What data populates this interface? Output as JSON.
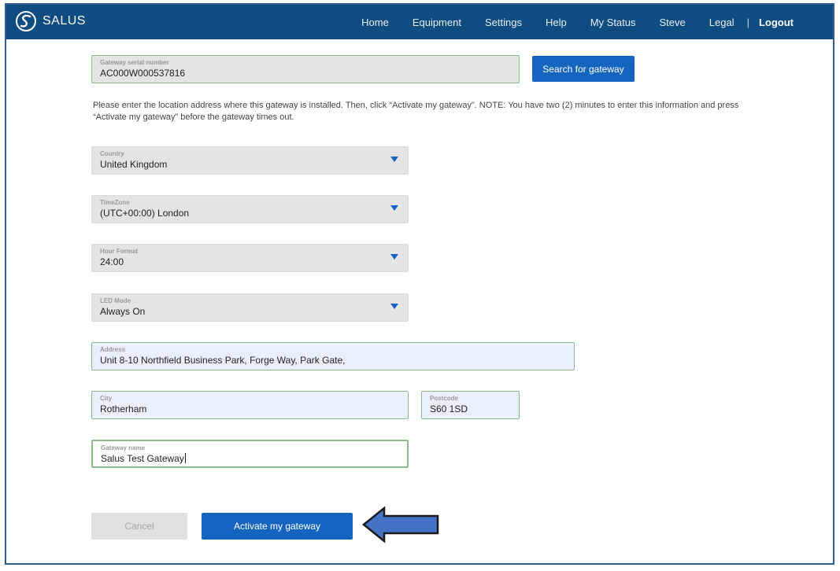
{
  "brand": {
    "name": "SALUS"
  },
  "nav": {
    "items": [
      "Home",
      "Equipment",
      "Settings",
      "Help",
      "My Status",
      "Steve",
      "Legal"
    ],
    "separator": "|",
    "logout": "Logout"
  },
  "gateway_serial": {
    "label": "Gateway serial number",
    "value": "AC000W000537816"
  },
  "search_button": "Search for gateway",
  "notice": "Please enter the location address where this gateway is installed. Then, click “Activate my gateway”. NOTE: You have two (2) minutes to enter this information and press “Activate my gateway” before the gateway times out.",
  "country": {
    "label": "Country",
    "value": "United Kingdom"
  },
  "timezone": {
    "label": "TimeZone",
    "value": "(UTC+00:00) London"
  },
  "hour_format": {
    "label": "Hour Format",
    "value": "24:00"
  },
  "led_mode": {
    "label": "LED Mode",
    "value": "Always On"
  },
  "address": {
    "label": "Address",
    "value": "Unit 8-10 Northfield Business Park, Forge Way, Park Gate,"
  },
  "city": {
    "label": "City",
    "value": "Rotherham"
  },
  "postcode": {
    "label": "Postcode",
    "value": "S60 1SD"
  },
  "gateway_name": {
    "label": "Gateway name",
    "value": "Salus Test Gateway"
  },
  "cancel_button": "Cancel",
  "activate_button": "Activate my gateway",
  "colors": {
    "navbar": "#0f4c81",
    "primary": "#1565c0",
    "arrow": "#4472c4"
  }
}
